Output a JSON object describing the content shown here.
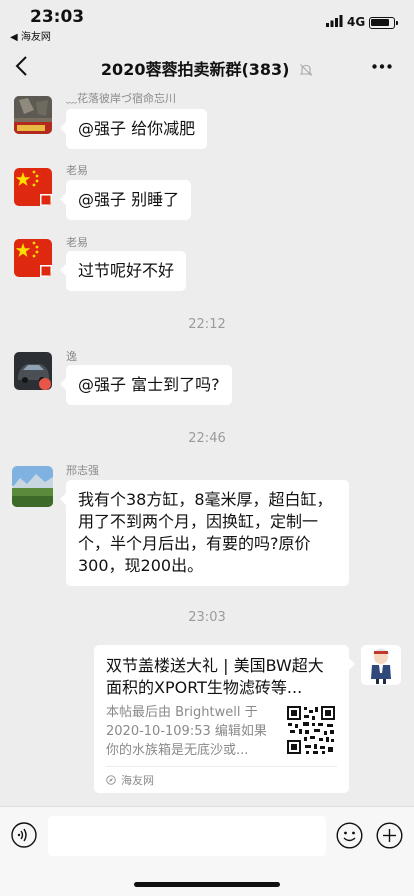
{
  "status_bar": {
    "time": "23:03",
    "back_app": "◀ 海友网",
    "network": "4G"
  },
  "nav": {
    "title": "2020蓉蓉拍卖新群(383)"
  },
  "messages": [
    {
      "sender": "﹏花落彼岸づ宿命忘川",
      "text": "@强子 给你减肥"
    },
    {
      "sender": "老易",
      "text": "@强子 别睡了"
    },
    {
      "sender": "老易",
      "text": "过节呢好不好"
    },
    {
      "sender": "逸",
      "text": "@强子 富士到了吗?"
    },
    {
      "sender": "邢志强",
      "text": "我有个38方缸，8毫米厚，超白缸，用了不到两个月，因换缸，定制一个，半个月后出，有要的吗?原价300，现200出。"
    }
  ],
  "timestamps": [
    "22:12",
    "22:46",
    "23:03"
  ],
  "card": {
    "title": "双节盖楼送大礼 | 美国BW超大面积的XPORT生物滤砖等...",
    "desc": "本帖最后由 Brightwell 于 2020-10-109:53 编辑如果你的水族箱是无底沙或...",
    "source": "海友网"
  },
  "input": {
    "value": ""
  }
}
